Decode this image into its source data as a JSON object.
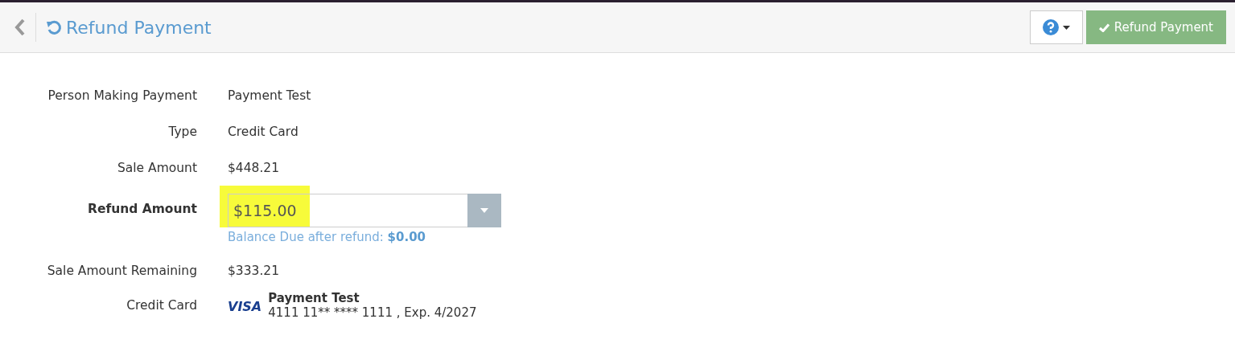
{
  "header": {
    "title": "Refund Payment",
    "action_button": "Refund Payment"
  },
  "rows": [
    {
      "kind": "text",
      "label": "Person Making Payment",
      "value": "Payment Test"
    },
    {
      "kind": "text",
      "label": "Type",
      "value": "Credit Card"
    },
    {
      "kind": "text",
      "label": "Sale Amount",
      "value": "$448.21"
    },
    {
      "kind": "input",
      "label": "Refund Amount",
      "value": "$115.00",
      "highlighted": true,
      "hint": "Balance Due after refund: **$0.00**"
    },
    {
      "kind": "text",
      "label": "Sale Amount Remaining",
      "value": "$333.21"
    },
    {
      "kind": "card",
      "label": "Credit Card",
      "brand": "VISA",
      "name": "Payment Test",
      "number": "4111 11** **** 1111 , Exp. 4/2027"
    }
  ]
}
